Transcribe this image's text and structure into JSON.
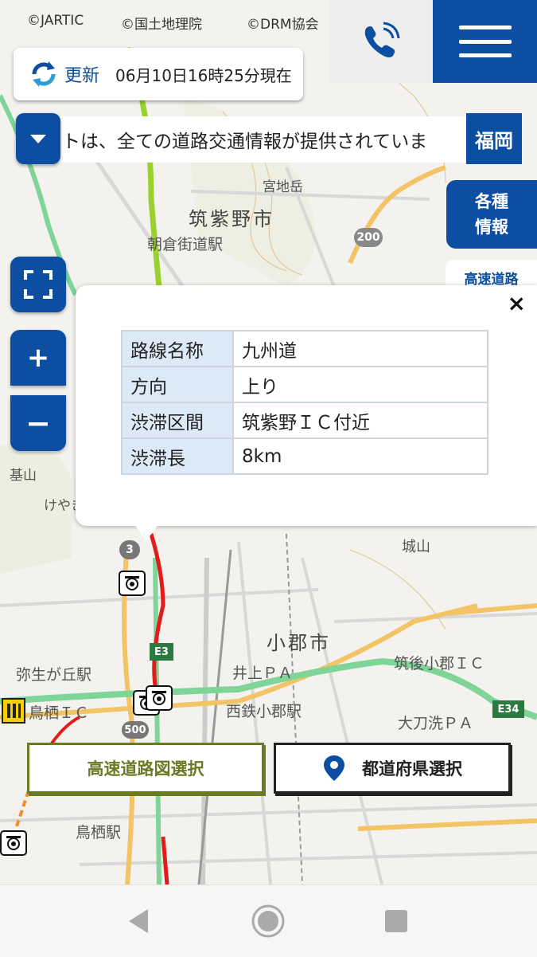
{
  "map": {
    "copyrights": [
      "©JARTIC",
      "©国土地理院",
      "©DRM協会"
    ],
    "labels": [
      "筑紫野市",
      "小郡市",
      "宮地岳",
      "朝倉街道駅",
      "西鉄小郡駅",
      "弥生が丘駅",
      "鳥栖駅",
      "井上ＰＡ",
      "大刀洗ＰＡ",
      "筑後小郡ＩＣ",
      "鳥栖ＩＣ",
      "城山",
      "基山",
      "けやき"
    ],
    "route_numbers": [
      "200",
      "3",
      "500",
      "E3",
      "E34"
    ]
  },
  "header": {
    "phone_icon": "phone-icon",
    "menu_icon": "hamburger-menu-icon"
  },
  "update": {
    "label": "更新",
    "time": "06月10日16時25分現在"
  },
  "ticker": {
    "text": "トは、全ての道路交通情報が提供されていま"
  },
  "prefecture_button": "福岡",
  "info_button": [
    "各種",
    "情報"
  ],
  "highway_tab": "高速道路",
  "controls": {
    "zoom_in": "+",
    "zoom_out": "−"
  },
  "popup": {
    "close": "×",
    "rows": [
      {
        "key": "路線名称",
        "value": "九州道"
      },
      {
        "key": "方向",
        "value": "上り"
      },
      {
        "key": "渋滞区間",
        "value": "筑紫野ＩＣ付近"
      },
      {
        "key": "渋滞長",
        "value": "8km"
      }
    ]
  },
  "bottom_buttons": {
    "highway_map": "高速道路図選択",
    "prefecture_select": "都道府県選択"
  },
  "colors": {
    "brand_blue": "#0b4ea2",
    "congestion_red": "#e21b1b",
    "highway_green": "#7fd497",
    "button_olive": "#6b7a23"
  }
}
